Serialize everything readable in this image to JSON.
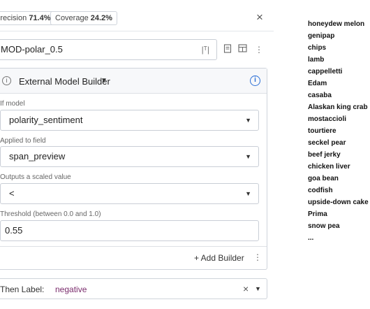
{
  "topbar": {
    "precision_label": "Precision",
    "precision_value": "71.4%",
    "coverage_label": "Coverage",
    "coverage_value": "24.2%",
    "close_symbol": "×"
  },
  "rule": {
    "name": "MOD-polar_0.5"
  },
  "builder": {
    "title": "External Model Builder",
    "fields": [
      {
        "label": "If model",
        "value": "polarity_sentiment"
      },
      {
        "label": "Applied to field",
        "value": "span_preview"
      },
      {
        "label": "Outputs a scaled value",
        "value": "<"
      },
      {
        "label": "Threshold (between 0.0 and 1.0)",
        "value": "0.55"
      }
    ],
    "add_label": "+ Add Builder"
  },
  "then": {
    "label": "Then Label:",
    "value": "negative"
  },
  "examples": [
    "honeydew melon",
    "genipap",
    "chips",
    "lamb",
    "cappelletti",
    "Edam",
    "casaba",
    "Alaskan king crab",
    "mostaccioli",
    "tourtiere",
    "seckel pear",
    "beef jerky",
    "chicken liver",
    "goa bean",
    "codfish",
    "upside-down cake",
    "Prima",
    "snow pea",
    "..."
  ],
  "colors": {
    "accent_blue": "#2b6fd6",
    "label_value": "#7b2d6d"
  }
}
